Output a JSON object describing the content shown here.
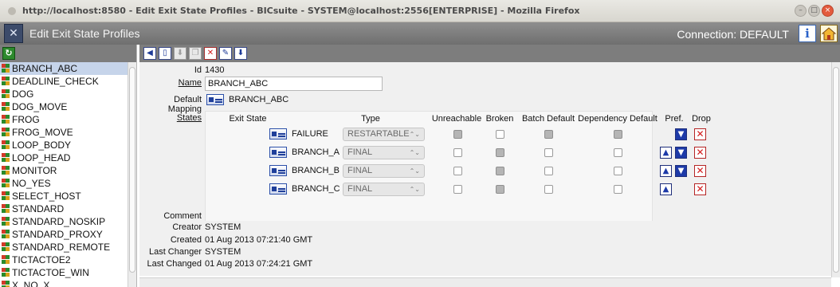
{
  "window": {
    "title": "http://localhost:8580 - Edit Exit State Profiles - BICsuite - SYSTEM@localhost:2556[ENTERPRISE] - Mozilla Firefox"
  },
  "app": {
    "title": "Edit Exit State Profiles",
    "connection": "Connection: DEFAULT"
  },
  "sidebar": {
    "items": [
      {
        "label": "BRANCH_ABC",
        "selected": true
      },
      {
        "label": "DEADLINE_CHECK"
      },
      {
        "label": "DOG"
      },
      {
        "label": "DOG_MOVE"
      },
      {
        "label": "FROG"
      },
      {
        "label": "FROG_MOVE"
      },
      {
        "label": "LOOP_BODY"
      },
      {
        "label": "LOOP_HEAD"
      },
      {
        "label": "MONITOR"
      },
      {
        "label": "NO_YES"
      },
      {
        "label": "SELECT_HOST"
      },
      {
        "label": "STANDARD"
      },
      {
        "label": "STANDARD_NOSKIP"
      },
      {
        "label": "STANDARD_PROXY"
      },
      {
        "label": "STANDARD_REMOTE"
      },
      {
        "label": "TICTACTOE2"
      },
      {
        "label": "TICTACTOE_WIN"
      },
      {
        "label": "X_NO_X"
      }
    ]
  },
  "detail": {
    "id_label": "Id",
    "id_value": "1430",
    "name_label": "Name",
    "name_value": "BRANCH_ABC",
    "default_mapping_label": "Default Mapping",
    "default_mapping_value": "BRANCH_ABC",
    "states_label": "States",
    "columns": {
      "exit_state": "Exit State",
      "type": "Type",
      "unreachable": "Unreachable",
      "broken": "Broken",
      "batch_default": "Batch Default",
      "dependency_default": "Dependency Default",
      "pref": "Pref.",
      "drop": "Drop"
    },
    "states": [
      {
        "name": "FAILURE",
        "type": "RESTARTABLE",
        "unreachable": true,
        "broken": false,
        "batch_default": true,
        "dependency_default": true,
        "up": false,
        "down": true
      },
      {
        "name": "BRANCH_A",
        "type": "FINAL",
        "unreachable": false,
        "broken": true,
        "batch_default": false,
        "dependency_default": false,
        "up": true,
        "down": true
      },
      {
        "name": "BRANCH_B",
        "type": "FINAL",
        "unreachable": false,
        "broken": true,
        "batch_default": false,
        "dependency_default": false,
        "up": true,
        "down": true
      },
      {
        "name": "BRANCH_C",
        "type": "FINAL",
        "unreachable": false,
        "broken": true,
        "batch_default": false,
        "dependency_default": false,
        "up": true,
        "down": false
      }
    ],
    "comment_label": "Comment",
    "comment_value": "",
    "creator_label": "Creator",
    "creator_value": "SYSTEM",
    "created_label": "Created",
    "created_value": "01 Aug 2013 07:21:40 GMT",
    "last_changer_label": "Last Changer",
    "last_changer_value": "SYSTEM",
    "last_changed_label": "Last Changed",
    "last_changed_value": "01 Aug 2013 07:24:21 GMT"
  },
  "icons": {
    "toolbar": [
      "back-icon",
      "new-icon",
      "save-icon",
      "copy-icon",
      "delete-icon",
      "edit-icon",
      "download-icon"
    ]
  }
}
